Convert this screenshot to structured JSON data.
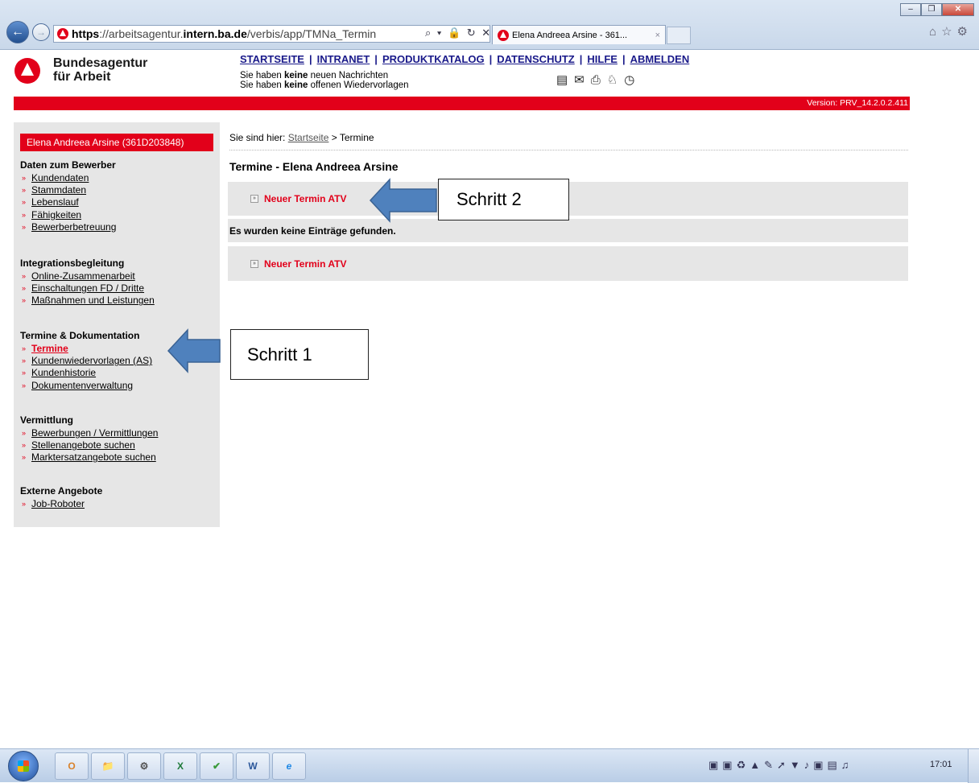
{
  "browser": {
    "address_protocol": "https",
    "address_host": "://arbeitsagentur.",
    "address_host_bold": "intern.ba.de",
    "address_path": "/verbis/app/TMNa_Termin",
    "address_tools": "⌕ ▾ 🔒 ↻ ✕",
    "tab_title": "Elena Andreea Arsine - 361...",
    "tab_close": "×",
    "win_minimize": "–",
    "win_restore": "❐",
    "win_close": "✕",
    "right_icons": "⌂☆⚙"
  },
  "header": {
    "logo_line1": "Bundesagentur",
    "logo_line2": "für Arbeit",
    "nav": [
      "STARTSEITE",
      "INTRANET",
      "PRODUKTKATALOG",
      "DATENSCHUTZ",
      "HILFE",
      "ABMELDEN"
    ],
    "nav_sep": "|",
    "msg1_a": "Sie haben ",
    "msg1_b": "keine",
    "msg1_c": " neuen Nachrichten",
    "msg2_a": "Sie haben ",
    "msg2_b": "keine",
    "msg2_c": " offenen Wiedervorlagen",
    "icons": "▤✉⎙♘◷",
    "version": "Version: PRV_14.2.0.2.411"
  },
  "sidebar": {
    "user": "Elena Andreea Arsine (361D203848)",
    "sections": [
      {
        "title": "Daten zum Bewerber",
        "items": [
          "Kundendaten",
          "Stammdaten",
          "Lebenslauf",
          "Fähigkeiten",
          "Bewerberbetreuung"
        ]
      },
      {
        "title": "Integrationsbegleitung",
        "items": [
          "Online-Zusammenarbeit",
          "Einschaltungen FD / Dritte",
          "Maßnahmen und Leistungen"
        ]
      },
      {
        "title": "Termine & Dokumentation",
        "items": [
          "Termine",
          "Kundenwiedervorlagen (AS)",
          "Kundenhistorie",
          "Dokumentenverwaltung"
        ]
      },
      {
        "title": "Vermittlung",
        "items": [
          "Bewerbungen / Vermittlungen",
          "Stellenangebote suchen",
          "Marktersatzangebote suchen"
        ]
      },
      {
        "title": "Externe Angebote",
        "items": [
          "Job-Roboter"
        ]
      }
    ],
    "chevron": "»"
  },
  "main": {
    "breadcrumb_prefix": "Sie sind hier: ",
    "breadcrumb_link": "Startseite",
    "breadcrumb_rest": " > Termine",
    "title": "Termine - Elena Andreea Arsine",
    "new_appointment": "Neuer Termin ATV",
    "box_glyph": "»",
    "no_entries": "Es wurden keine Einträge gefunden."
  },
  "annotations": {
    "step1": "Schritt  1",
    "step2": "Schritt 2",
    "arrow_color": "#4f81bd"
  },
  "taskbar": {
    "apps": [
      "O",
      "📁",
      "⚙",
      "X",
      "✔",
      "W",
      "e"
    ],
    "tray": "▣▣♻▲✎➚▼♪▣▤♫",
    "clock": "17:01"
  }
}
